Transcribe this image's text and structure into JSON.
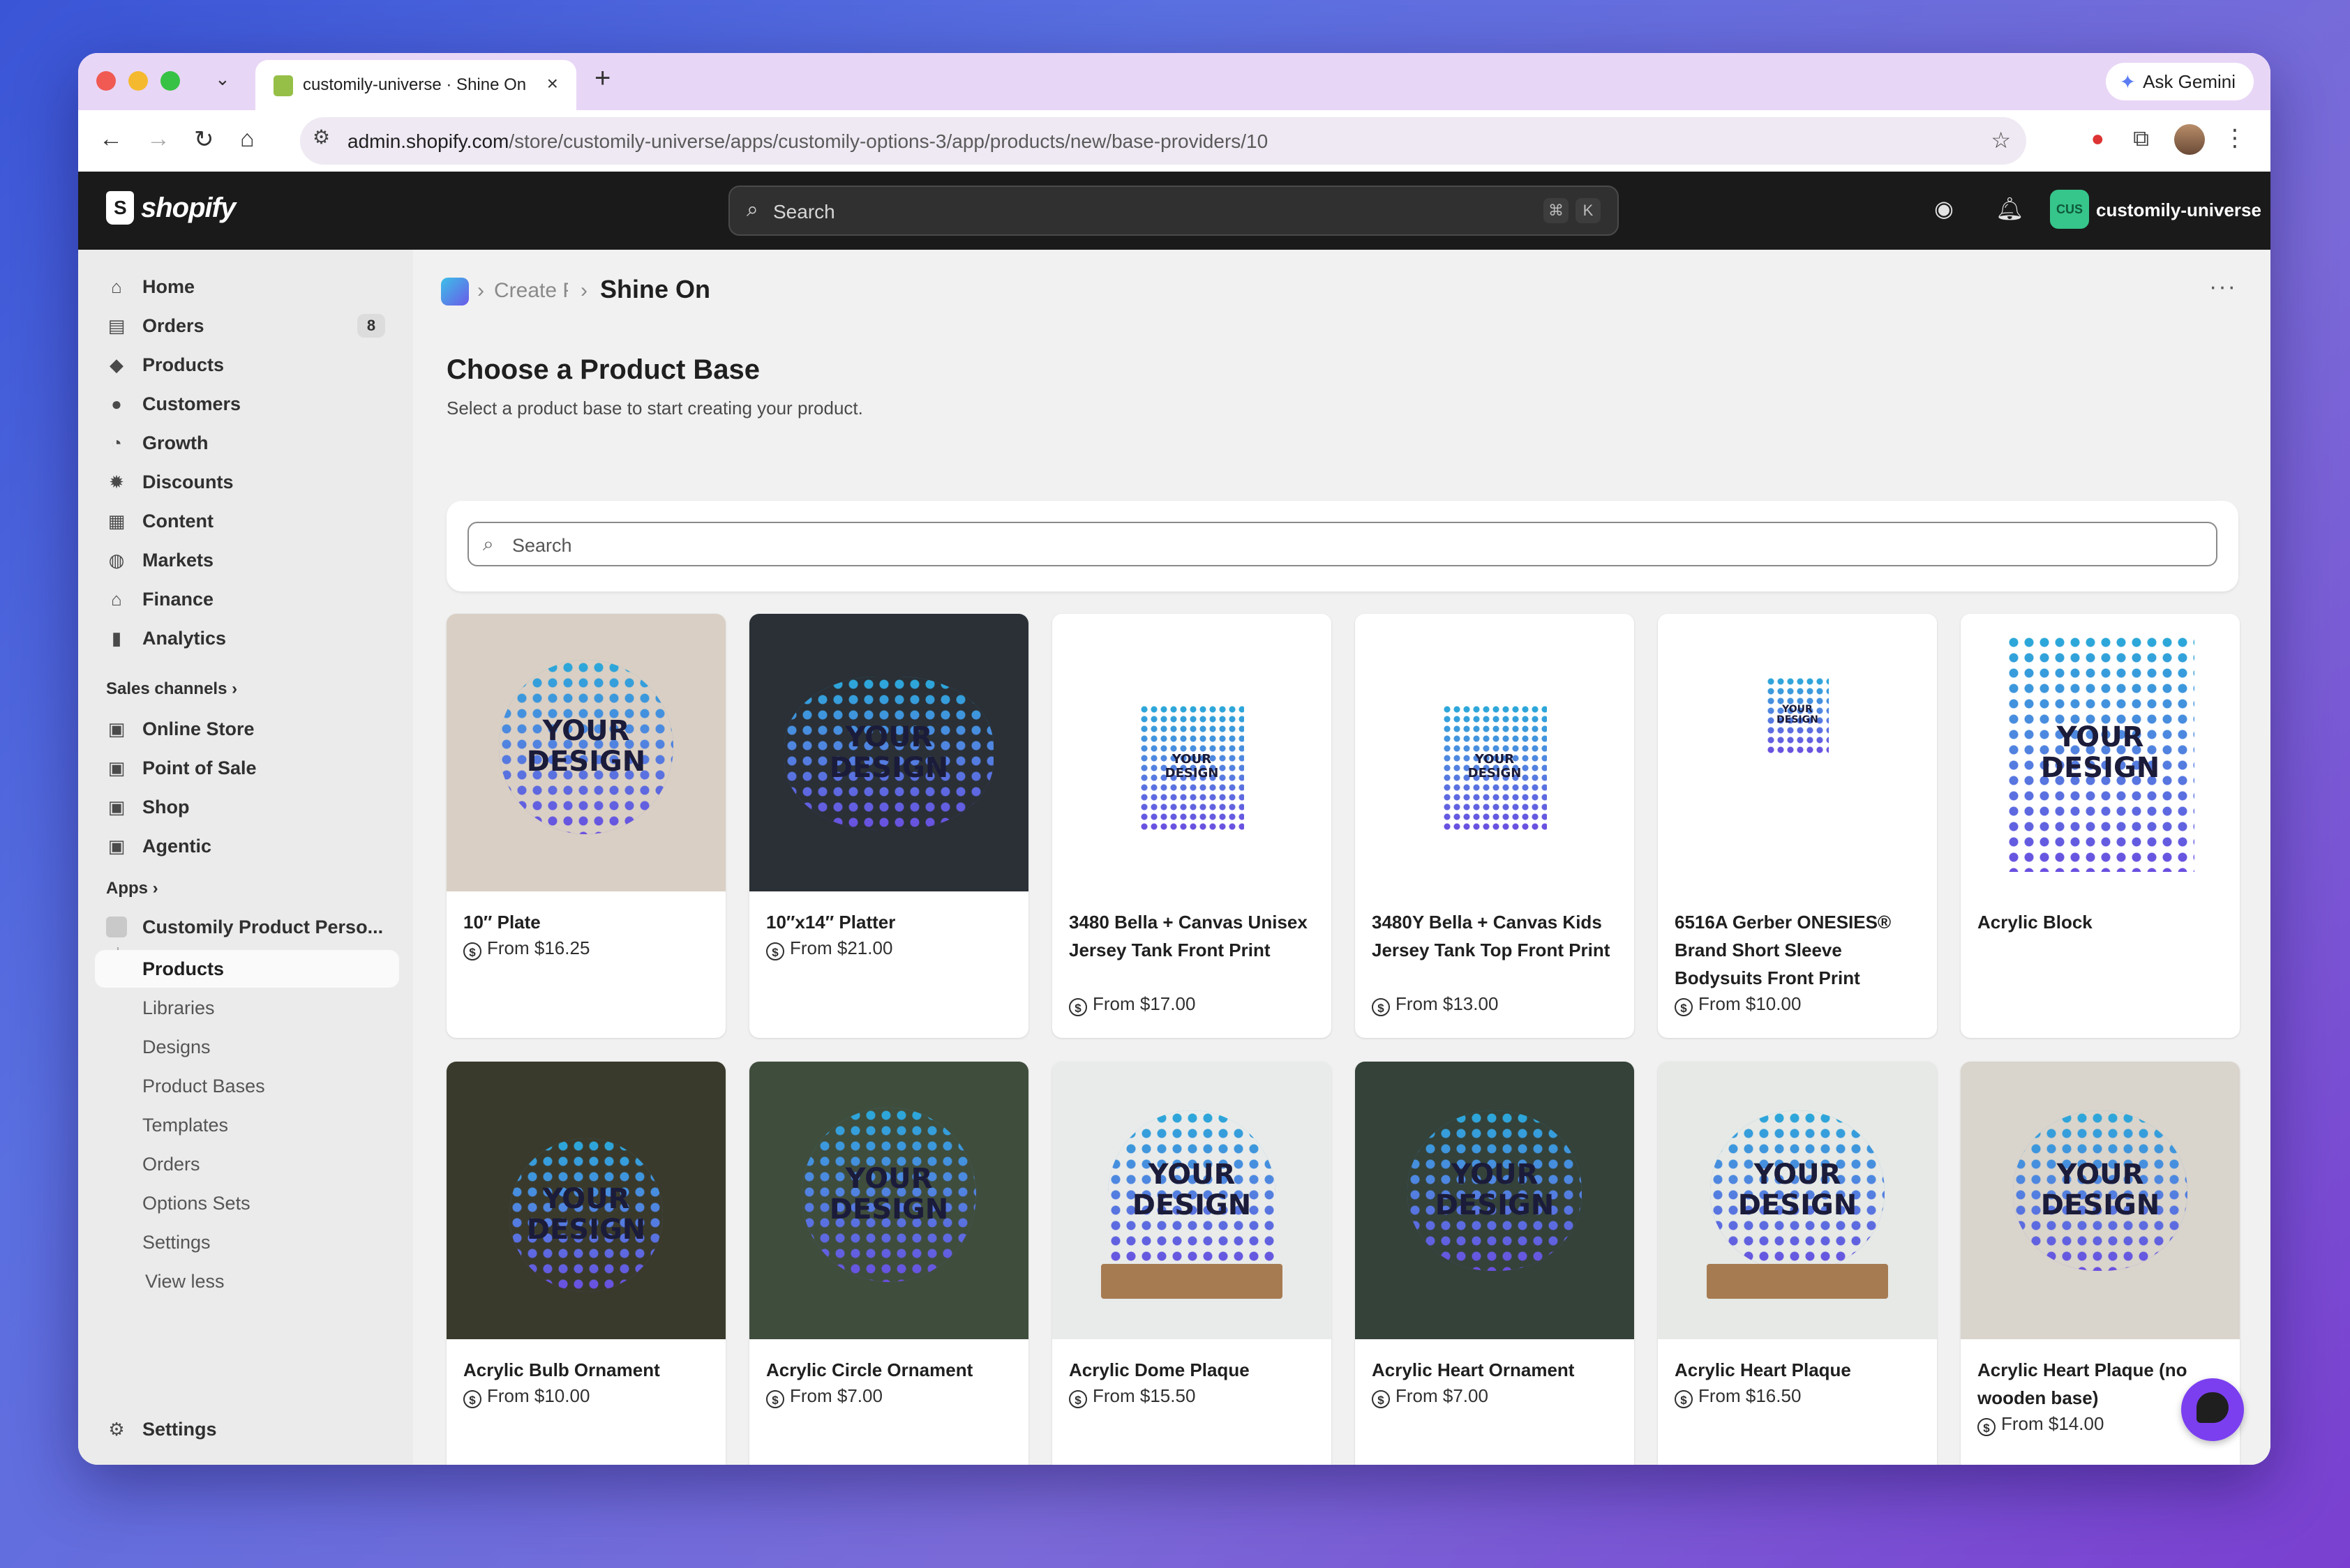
{
  "browser": {
    "tab_title": "customily-universe · Shine On",
    "url_domain": "admin.shopify.com",
    "url_path": "/store/customily-universe/apps/customily-options-3/app/products/new/base-providers/10",
    "ask_gemini": "Ask Gemini"
  },
  "topbar": {
    "logo_text": "shopify",
    "search_placeholder": "Search",
    "kbd_cmd": "⌘",
    "kbd_k": "K",
    "store_badge": "CUS",
    "store_name": "customily-universe"
  },
  "sidebar": {
    "items": [
      {
        "label": "Home",
        "icon": "home-icon"
      },
      {
        "label": "Orders",
        "icon": "orders-icon",
        "count": "8"
      },
      {
        "label": "Products",
        "icon": "tag-icon"
      },
      {
        "label": "Customers",
        "icon": "person-icon"
      },
      {
        "label": "Growth",
        "icon": "gauge-icon"
      },
      {
        "label": "Discounts",
        "icon": "discount-icon"
      },
      {
        "label": "Content",
        "icon": "content-icon"
      },
      {
        "label": "Markets",
        "icon": "globe-icon"
      },
      {
        "label": "Finance",
        "icon": "bank-icon"
      },
      {
        "label": "Analytics",
        "icon": "bar-chart-icon"
      }
    ],
    "sales_channels_heading": "Sales channels",
    "channels": [
      {
        "label": "Online Store",
        "icon": "store-icon"
      },
      {
        "label": "Point of Sale",
        "icon": "pos-icon"
      },
      {
        "label": "Shop",
        "icon": "shop-icon"
      },
      {
        "label": "Agentic",
        "icon": "agentic-icon"
      }
    ],
    "apps_heading": "Apps",
    "app_name": "Customily Product Perso...",
    "app_subitems": [
      "Products",
      "Libraries",
      "Designs",
      "Product Bases",
      "Templates",
      "Orders",
      "Options Sets",
      "Settings"
    ],
    "view_less": "View less",
    "settings": "Settings"
  },
  "main": {
    "breadcrumb_create": "Create P",
    "breadcrumb_title": "Shine On",
    "page_title": "Choose a Product Base",
    "page_subtitle": "Select a product base to start creating your product.",
    "search_placeholder": "Search",
    "design_line1": "YOUR",
    "design_line2": "DESIGN",
    "products": [
      {
        "name": "10″ Plate",
        "price": "From $16.25",
        "bg": "#d9cfc4",
        "shape": "circle"
      },
      {
        "name": "10″x14″ Platter",
        "price": "From $21.00",
        "bg": "#2a3036",
        "shape": "oval"
      },
      {
        "name": "3480 Bella + Canvas Unisex Jersey Tank Front Print",
        "price": "From $17.00",
        "bg": "#ffffff",
        "shape": "tank"
      },
      {
        "name": "3480Y Bella + Canvas Kids Jersey Tank Top Front Print",
        "price": "From $13.00",
        "bg": "#ffffff",
        "shape": "tank"
      },
      {
        "name": "6516A Gerber ONESIES® Brand Short Sleeve Bodysuits Front Print",
        "price": "From $10.00",
        "bg": "#ffffff",
        "shape": "onesie"
      },
      {
        "name": "Acrylic Block",
        "price": "",
        "bg": "#ffffff",
        "shape": "block"
      },
      {
        "name": "Acrylic Bulb Ornament",
        "price": "From $10.00",
        "bg": "#3a3a2c",
        "shape": "bulb"
      },
      {
        "name": "Acrylic Circle Ornament",
        "price": "From $7.00",
        "bg": "#3f4d3d",
        "shape": "circle"
      },
      {
        "name": "Acrylic Dome Plaque",
        "price": "From $15.50",
        "bg": "#e9ebea",
        "shape": "dome"
      },
      {
        "name": "Acrylic Heart Ornament",
        "price": "From $7.00",
        "bg": "#34423a",
        "shape": "heart"
      },
      {
        "name": "Acrylic Heart Plaque",
        "price": "From $16.50",
        "bg": "#e6e9e6",
        "shape": "heart"
      },
      {
        "name": "Acrylic Heart Plaque (no wooden base)",
        "price": "From $14.00",
        "bg": "#d9d4cc",
        "shape": "heart"
      }
    ]
  }
}
